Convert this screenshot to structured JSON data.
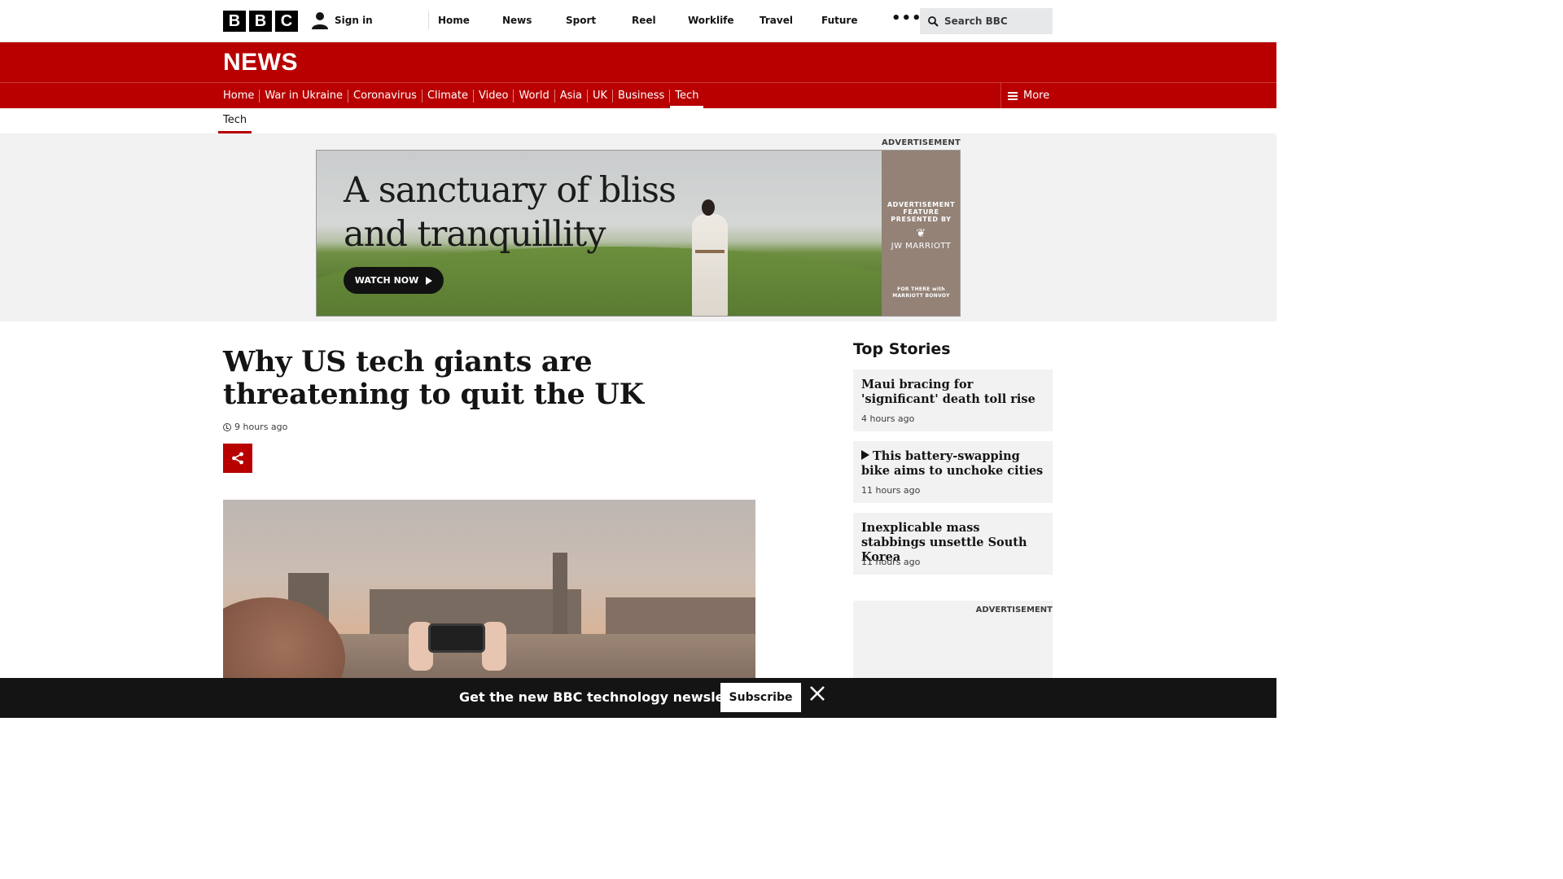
{
  "bbc_bar": {
    "logo_letters": [
      "B",
      "B",
      "C"
    ],
    "signin_label": "Sign in",
    "nav": [
      "Home",
      "News",
      "Sport",
      "Reel",
      "Worklife",
      "Travel",
      "Future"
    ],
    "more_label": "•••",
    "search_placeholder": "Search BBC"
  },
  "masthead": {
    "wordmark": "NEWS"
  },
  "section_nav": {
    "items": [
      "Home",
      "War in Ukraine",
      "Coronavirus",
      "Climate",
      "Video",
      "World",
      "Asia",
      "UK",
      "Business",
      "Tech"
    ],
    "active": "Tech",
    "more_label": "More"
  },
  "sub_nav": {
    "current": "Tech"
  },
  "advert_top": {
    "label": "ADVERTISEMENT",
    "headline": "A sanctuary of bliss and tranquillity",
    "cta": "WATCH NOW",
    "feature_text": "ADVERTISEMENT FEATURE PRESENTED BY",
    "brand": "JW MARRIOTT",
    "brand_small": "FOR THERE with MARRIOTT BONVOY"
  },
  "article": {
    "headline": "Why US tech giants are threatening to quit the UK",
    "timestamp": "9 hours ago"
  },
  "top_stories": {
    "title": "Top Stories",
    "items": [
      {
        "title": "Maui bracing for 'significant' death toll rise",
        "time": "4 hours ago",
        "video": false
      },
      {
        "title": "This battery-swapping bike aims to unchoke cities",
        "time": "11 hours ago",
        "video": true
      },
      {
        "title": "Inexplicable mass stabbings unsettle South Korea",
        "time": "11 hours ago",
        "video": false
      }
    ]
  },
  "side_advert": {
    "label": "ADVERTISEMENT"
  },
  "newsletter": {
    "text": "Get the new BBC technology newsletter",
    "subscribe_label": "Subscribe"
  },
  "colors": {
    "brand_red": "#b80000",
    "dark": "#141414"
  }
}
